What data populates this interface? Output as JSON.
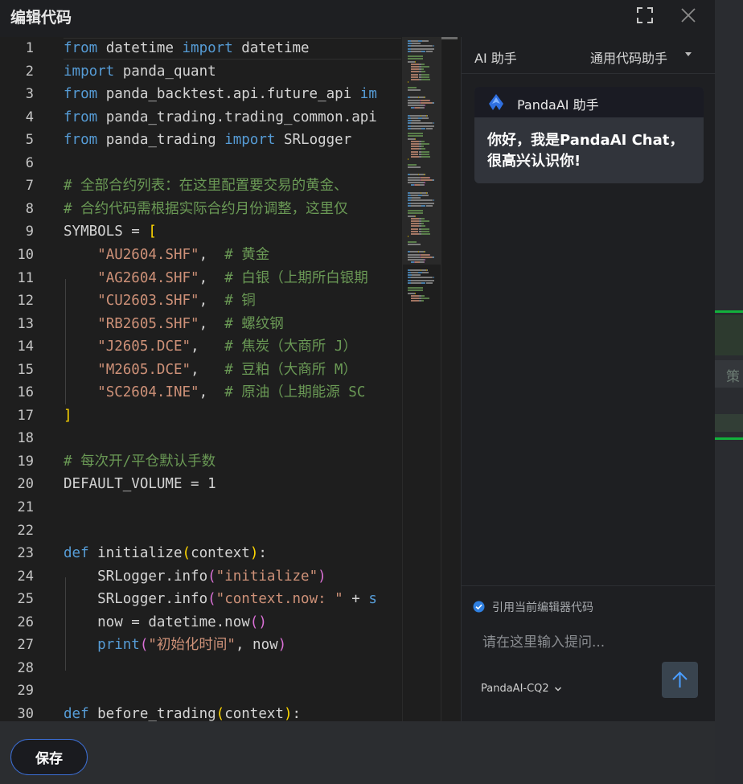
{
  "dialog": {
    "title": "编辑代码"
  },
  "background": {
    "partial_text": "策"
  },
  "editor": {
    "lines": [
      {
        "n": "1",
        "tokens": [
          {
            "t": "from",
            "c": "kw"
          },
          {
            "t": " datetime ",
            "c": ""
          },
          {
            "t": "import",
            "c": "kw"
          },
          {
            "t": " datetime",
            "c": ""
          }
        ]
      },
      {
        "n": "2",
        "tokens": [
          {
            "t": "import",
            "c": "kw"
          },
          {
            "t": " panda_quant",
            "c": ""
          }
        ]
      },
      {
        "n": "3",
        "tokens": [
          {
            "t": "from",
            "c": "kw"
          },
          {
            "t": " panda_backtest.api.future_api ",
            "c": ""
          },
          {
            "t": "im",
            "c": "kw"
          }
        ]
      },
      {
        "n": "4",
        "tokens": [
          {
            "t": "from",
            "c": "kw"
          },
          {
            "t": " panda_trading.trading_common.api",
            "c": ""
          }
        ]
      },
      {
        "n": "5",
        "tokens": [
          {
            "t": "from",
            "c": "kw"
          },
          {
            "t": " panda_trading ",
            "c": ""
          },
          {
            "t": "import",
            "c": "kw"
          },
          {
            "t": " SRLogger",
            "c": ""
          }
        ]
      },
      {
        "n": "6",
        "tokens": []
      },
      {
        "n": "7",
        "tokens": [
          {
            "t": "# 全部合约列表：在这里配置要交易的黄金、",
            "c": "cm"
          }
        ]
      },
      {
        "n": "8",
        "tokens": [
          {
            "t": "# 合约代码需根据实际合约月份调整，这里仅",
            "c": "cm"
          }
        ]
      },
      {
        "n": "9",
        "tokens": [
          {
            "t": "SYMBOLS = ",
            "c": ""
          },
          {
            "t": "[",
            "c": "br"
          }
        ]
      },
      {
        "n": "10",
        "tokens": [
          {
            "t": "    ",
            "c": ""
          },
          {
            "t": "\"AU2604.SHF\"",
            "c": "str"
          },
          {
            "t": ",  ",
            "c": ""
          },
          {
            "t": "# 黄金",
            "c": "cm"
          }
        ]
      },
      {
        "n": "11",
        "tokens": [
          {
            "t": "    ",
            "c": ""
          },
          {
            "t": "\"AG2604.SHF\"",
            "c": "str"
          },
          {
            "t": ",  ",
            "c": ""
          },
          {
            "t": "# 白银（上期所白银期",
            "c": "cm"
          }
        ]
      },
      {
        "n": "12",
        "tokens": [
          {
            "t": "    ",
            "c": ""
          },
          {
            "t": "\"CU2603.SHF\"",
            "c": "str"
          },
          {
            "t": ",  ",
            "c": ""
          },
          {
            "t": "# 铜",
            "c": "cm"
          }
        ]
      },
      {
        "n": "13",
        "tokens": [
          {
            "t": "    ",
            "c": ""
          },
          {
            "t": "\"RB2605.SHF\"",
            "c": "str"
          },
          {
            "t": ",  ",
            "c": ""
          },
          {
            "t": "# 螺纹钢",
            "c": "cm"
          }
        ]
      },
      {
        "n": "14",
        "tokens": [
          {
            "t": "    ",
            "c": ""
          },
          {
            "t": "\"J2605.DCE\"",
            "c": "str"
          },
          {
            "t": ",   ",
            "c": ""
          },
          {
            "t": "# 焦炭（大商所 J）",
            "c": "cm"
          }
        ]
      },
      {
        "n": "15",
        "tokens": [
          {
            "t": "    ",
            "c": ""
          },
          {
            "t": "\"M2605.DCE\"",
            "c": "str"
          },
          {
            "t": ",   ",
            "c": ""
          },
          {
            "t": "# 豆粕（大商所 M）",
            "c": "cm"
          }
        ]
      },
      {
        "n": "16",
        "tokens": [
          {
            "t": "    ",
            "c": ""
          },
          {
            "t": "\"SC2604.INE\"",
            "c": "str"
          },
          {
            "t": ",  ",
            "c": ""
          },
          {
            "t": "# 原油（上期能源 SC",
            "c": "cm"
          }
        ]
      },
      {
        "n": "17",
        "tokens": [
          {
            "t": "]",
            "c": "br"
          }
        ]
      },
      {
        "n": "18",
        "tokens": []
      },
      {
        "n": "19",
        "tokens": [
          {
            "t": "# 每次开/平仓默认手数",
            "c": "cm"
          }
        ]
      },
      {
        "n": "20",
        "tokens": [
          {
            "t": "DEFAULT_VOLUME = 1",
            "c": ""
          }
        ]
      },
      {
        "n": "21",
        "tokens": []
      },
      {
        "n": "22",
        "tokens": []
      },
      {
        "n": "23",
        "tokens": [
          {
            "t": "def",
            "c": "kw"
          },
          {
            "t": " initialize",
            "c": "fn"
          },
          {
            "t": "(",
            "c": "br"
          },
          {
            "t": "context",
            "c": ""
          },
          {
            "t": ")",
            "c": "br"
          },
          {
            "t": ":",
            "c": ""
          }
        ]
      },
      {
        "n": "24",
        "tokens": [
          {
            "t": "    SRLogger.info",
            "c": ""
          },
          {
            "t": "(",
            "c": "br2"
          },
          {
            "t": "\"initialize\"",
            "c": "str"
          },
          {
            "t": ")",
            "c": "br2"
          }
        ]
      },
      {
        "n": "25",
        "tokens": [
          {
            "t": "    SRLogger.info",
            "c": ""
          },
          {
            "t": "(",
            "c": "br2"
          },
          {
            "t": "\"context.now: \"",
            "c": "str"
          },
          {
            "t": " + ",
            "c": ""
          },
          {
            "t": "s",
            "c": "kw"
          }
        ]
      },
      {
        "n": "26",
        "tokens": [
          {
            "t": "    now = datetime.now",
            "c": ""
          },
          {
            "t": "()",
            "c": "br2"
          }
        ]
      },
      {
        "n": "27",
        "tokens": [
          {
            "t": "    ",
            "c": ""
          },
          {
            "t": "print",
            "c": "kw"
          },
          {
            "t": "(",
            "c": "br2"
          },
          {
            "t": "\"初始化时间\"",
            "c": "str"
          },
          {
            "t": ", now",
            "c": ""
          },
          {
            "t": ")",
            "c": "br2"
          }
        ]
      },
      {
        "n": "28",
        "tokens": []
      },
      {
        "n": "29",
        "tokens": []
      },
      {
        "n": "30",
        "tokens": [
          {
            "t": "def",
            "c": "kw"
          },
          {
            "t": " before_trading",
            "c": "fn"
          },
          {
            "t": "(",
            "c": "br"
          },
          {
            "t": "context",
            "c": ""
          },
          {
            "t": ")",
            "c": "br"
          },
          {
            "t": ":",
            "c": ""
          }
        ]
      }
    ]
  },
  "ai": {
    "title": "AI 助手",
    "mode": "通用代码助手",
    "assistant_name": "PandaAI 助手",
    "greeting": "你好，我是PandaAI Chat，很高兴认识你!",
    "reference_label": "引用当前编辑器代码",
    "input_placeholder": "请在这里输入提问...",
    "model": "PandaAI-CQ2"
  },
  "footer": {
    "save_label": "保存"
  },
  "colors": {
    "accent": "#3c6fd6",
    "keyword": "#569cd6",
    "string": "#ce9178",
    "comment": "#6a9955"
  }
}
